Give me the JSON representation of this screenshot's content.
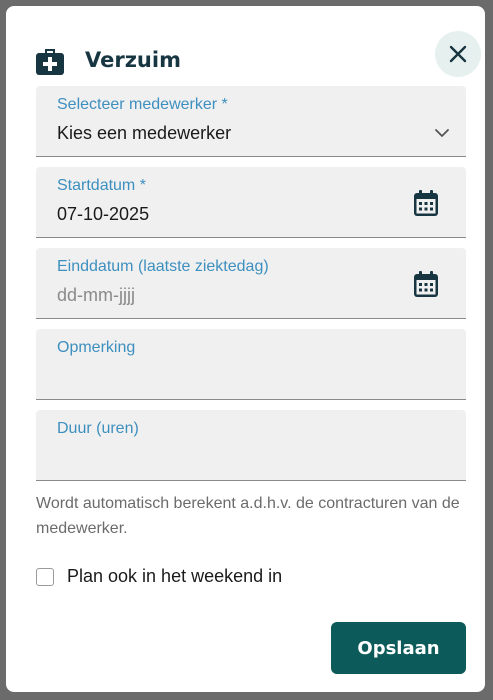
{
  "dialog": {
    "title": "Verzuim",
    "title_icon": "medical-bag-icon",
    "close_icon": "close-icon"
  },
  "fields": {
    "employee": {
      "label": "Selecteer medewerker *",
      "value": "Kies een medewerker",
      "icon": "chevron-down-icon"
    },
    "start_date": {
      "label": "Startdatum *",
      "value": "07-10-2025",
      "icon": "calendar-icon"
    },
    "end_date": {
      "label": "Einddatum (laatste ziektedag)",
      "placeholder": "dd-mm-jjjj",
      "icon": "calendar-icon"
    },
    "remark": {
      "label": "Opmerking",
      "value": ""
    },
    "duration": {
      "label": "Duur (uren)",
      "value": ""
    }
  },
  "hint": "Wordt automatisch berekent a.d.h.v. de contracturen van de medewerker.",
  "weekend_checkbox": {
    "label": "Plan ook in het weekend in",
    "checked": false
  },
  "save_button": {
    "label": "Opslaan"
  },
  "colors": {
    "accent": "#0c5a5a",
    "label": "#3d8fbf",
    "title": "#173642",
    "close_bg": "#e6f1ef",
    "field_bg": "#f0f0f0"
  }
}
